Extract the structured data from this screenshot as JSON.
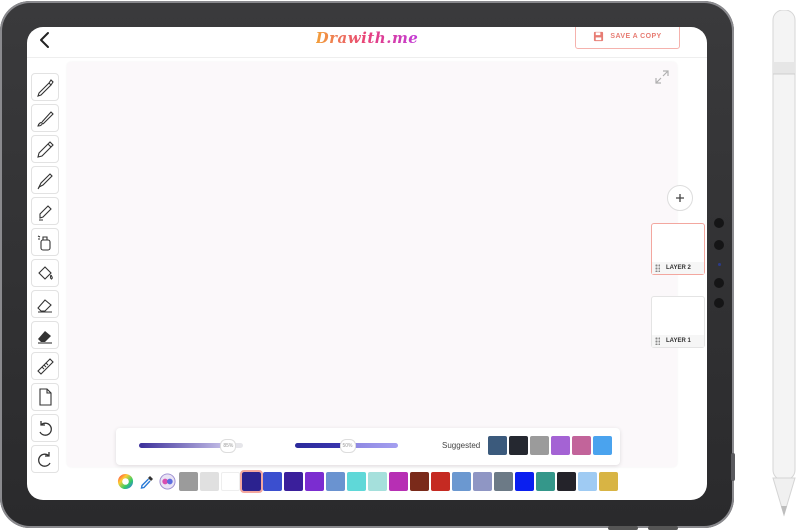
{
  "app": {
    "logo_text": "Drawith.me",
    "save_label": "SAVE A COPY"
  },
  "tools": [
    "pen-icon",
    "brush-icon",
    "pencil-icon",
    "marker-icon",
    "highlighter-icon",
    "spray-icon",
    "paint-bucket-icon",
    "eraser-icon",
    "hard-eraser-icon",
    "ruler-icon",
    "blank-page-icon",
    "undo-icon",
    "redo-icon"
  ],
  "layers": [
    {
      "label": "LAYER 2",
      "active": true
    },
    {
      "label": "LAYER 1",
      "active": false
    }
  ],
  "sliders": {
    "size_value": "85%",
    "size_level": 0.85,
    "opacity_value": "50%",
    "opacity_level": 0.5
  },
  "suggested": {
    "label": "Suggested",
    "colors": [
      "#3b5a7c",
      "#252830",
      "#9b9b9b",
      "#a463d4",
      "#c2649a",
      "#4aa3ee"
    ]
  },
  "palette": {
    "selected_index": 3,
    "colors": [
      "#9b9b9b",
      "#e0e0e0",
      "#ffffff",
      "#2b228f",
      "#3b4fcf",
      "#3a1f9b",
      "#7b2dd0",
      "#6a93d0",
      "#5fd8d8",
      "#a5e0dc",
      "#b72fb4",
      "#7a2a1a",
      "#c52a22",
      "#6b98d0",
      "#8f96c4",
      "#6c7a86",
      "#0a1ff0",
      "#34978a",
      "#24232a",
      "#9fcbf3",
      "#d8b444"
    ]
  }
}
